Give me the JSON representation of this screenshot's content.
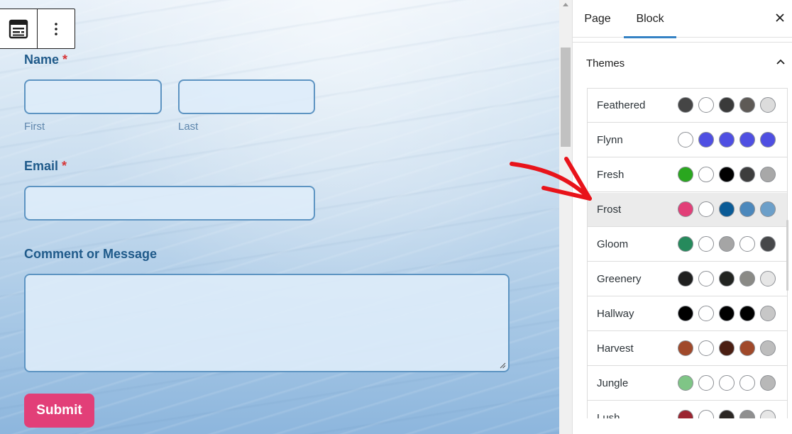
{
  "form": {
    "name_label": "Name",
    "required_mark": "*",
    "first_sublabel": "First",
    "last_sublabel": "Last",
    "email_label": "Email",
    "comment_label": "Comment or Message",
    "submit_label": "Submit"
  },
  "toolbar": {
    "block_icon": "form-block-icon",
    "more_icon": "more-vertical-icon"
  },
  "sidebar": {
    "tabs": [
      {
        "label": "Page"
      },
      {
        "label": "Block"
      }
    ],
    "active_tab": "Block",
    "close_icon": "close-icon",
    "section_title": "Themes",
    "section_toggle_icon": "chevron-up-icon",
    "selected_theme": "Frost",
    "themes": [
      {
        "name": "Feathered",
        "colors": [
          "#454545",
          "#ffffff",
          "#3a3a3a",
          "#5e5a56",
          "#dcdcdc"
        ]
      },
      {
        "name": "Flynn",
        "colors": [
          "#ffffff",
          "#4f4fe2",
          "#4f4fe2",
          "#4f4fe2",
          "#4f4fe2"
        ]
      },
      {
        "name": "Fresh",
        "colors": [
          "#2aa71f",
          "#ffffff",
          "#000000",
          "#3d3d3d",
          "#a8a8a8"
        ]
      },
      {
        "name": "Frost",
        "colors": [
          "#e23f78",
          "#ffffff",
          "#0b5b96",
          "#4c88bc",
          "#6c9fc9"
        ]
      },
      {
        "name": "Gloom",
        "colors": [
          "#268a5c",
          "#ffffff",
          "#a5a5a5",
          "#ffffff",
          "#47484a"
        ]
      },
      {
        "name": "Greenery",
        "colors": [
          "#1f1f1f",
          "#ffffff",
          "#222421",
          "#8a8a86",
          "#e6e6e6"
        ]
      },
      {
        "name": "Hallway",
        "colors": [
          "#000000",
          "#ffffff",
          "#000000",
          "#000000",
          "#c7c7c7"
        ]
      },
      {
        "name": "Harvest",
        "colors": [
          "#a0492a",
          "#ffffff",
          "#4a1e12",
          "#a0492a",
          "#bdbdbd"
        ]
      },
      {
        "name": "Jungle",
        "colors": [
          "#7fc586",
          "#ffffff",
          "#ffffff",
          "#ffffff",
          "#b8b8b8"
        ]
      },
      {
        "name": "Lush",
        "colors": [
          "#9b2530",
          "#ffffff",
          "#2b2623",
          "#8f8f8f",
          "#e6e6e6"
        ]
      }
    ]
  },
  "colors": {
    "accent": "#3582c4",
    "submit_button": "#e23f78",
    "label_text": "#1f5a8a",
    "annotation_arrow": "#e8131a"
  }
}
